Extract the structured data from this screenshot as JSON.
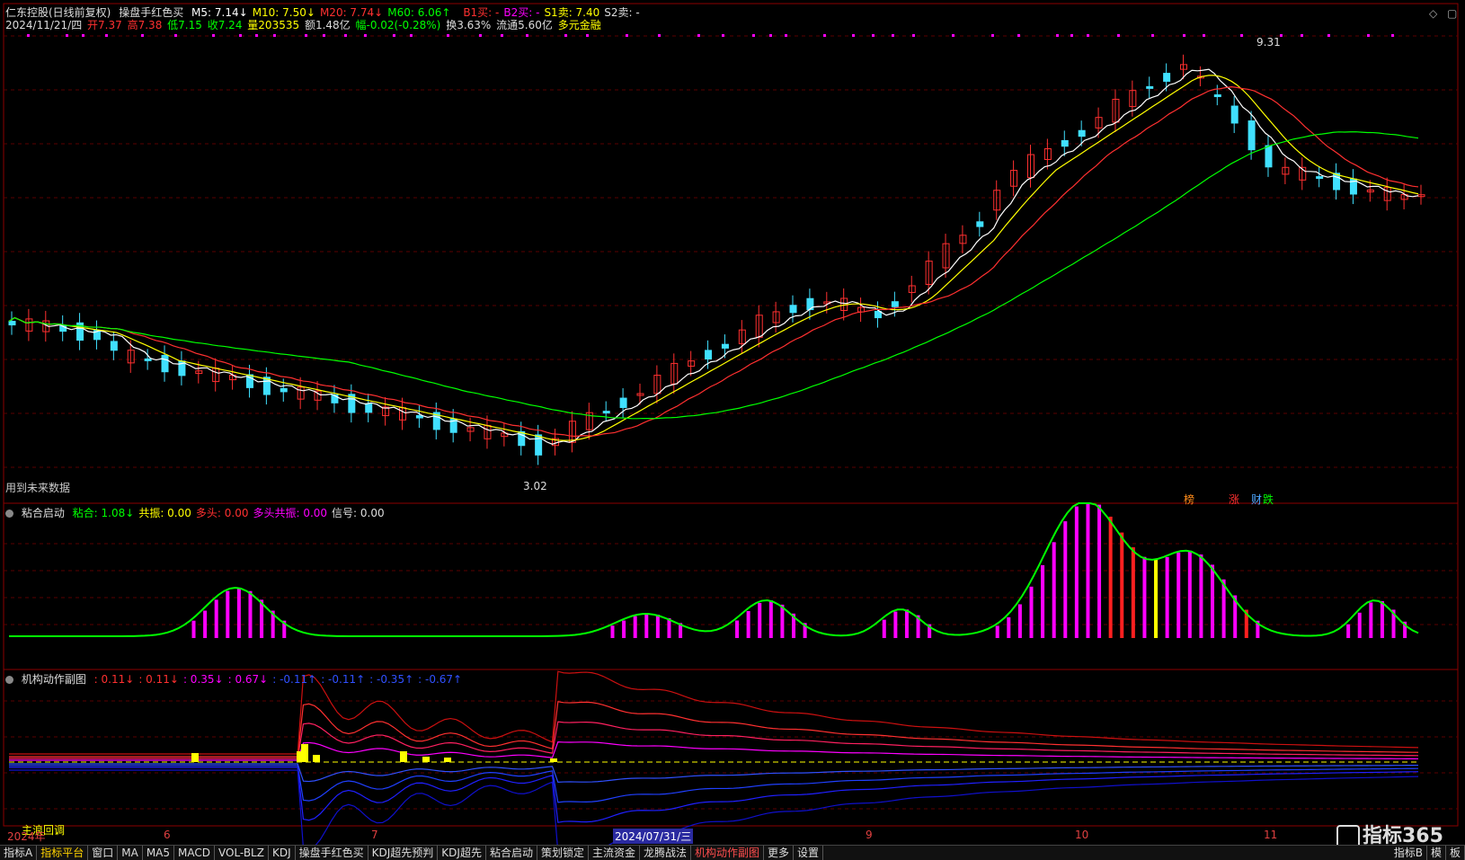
{
  "main": {
    "stock_name": "仁东控股(日线前复权)",
    "indicator_name": "操盘手红色买",
    "ma": [
      {
        "label": "M5: 7.14",
        "arrow": "↓",
        "color": "#ffffff"
      },
      {
        "label": "M10: 7.50",
        "arrow": "↓",
        "color": "#ffff00"
      },
      {
        "label": "M20: 7.74",
        "arrow": "↓",
        "color": "#ff3030"
      },
      {
        "label": "M60: 6.06",
        "arrow": "↑",
        "color": "#00ff00"
      }
    ],
    "signals": [
      {
        "label": "B1买: -",
        "color": "#ff3030"
      },
      {
        "label": "B2买: -",
        "color": "#ff00ff"
      },
      {
        "label": "S1卖: 7.40",
        "color": "#ffff00"
      },
      {
        "label": "S2卖: -",
        "color": "#dddddd"
      }
    ],
    "quote": {
      "date": "2024/11/21/四",
      "open": "开7.37",
      "high": "高7.38",
      "low": "低7.15",
      "close": "收7.24",
      "volume": "量203535",
      "amount": "额1.48亿",
      "change": "幅-0.02(-0.28%)",
      "turnover": "换3.63%",
      "float": "流通5.60亿",
      "tag": "多元金融"
    },
    "high_label": "9.31",
    "low_label": "3.02",
    "future_note": "用到未来数据",
    "badges": [
      "榜",
      "涨",
      "财",
      "跌"
    ]
  },
  "ind1": {
    "name": "粘合启动",
    "values": [
      {
        "label": "粘合: 1.08",
        "arrow": "↓",
        "color": "#00ff00"
      },
      {
        "label": "共振: 0.00",
        "arrow": "",
        "color": "#ffff00"
      },
      {
        "label": "多头: 0.00",
        "arrow": "",
        "color": "#ff3030"
      },
      {
        "label": "多头共振: 0.00",
        "arrow": "",
        "color": "#ff00ff"
      },
      {
        "label": "信号: 0.00",
        "arrow": "",
        "color": "#dddddd"
      }
    ]
  },
  "ind2": {
    "name": "机构动作副图",
    "values": [
      {
        "label": ": 0.11",
        "arrow": "↓",
        "color": "#ff3030"
      },
      {
        "label": ": 0.11",
        "arrow": "↓",
        "color": "#ff3030"
      },
      {
        "label": ": 0.35",
        "arrow": "↓",
        "color": "#ff00ff"
      },
      {
        "label": ": 0.67",
        "arrow": "↓",
        "color": "#ff00ff"
      },
      {
        "label": ": -0.11",
        "arrow": "↑",
        "color": "#3050ff"
      },
      {
        "label": ": -0.11",
        "arrow": "↑",
        "color": "#3050ff"
      },
      {
        "label": ": -0.35",
        "arrow": "↑",
        "color": "#3050ff"
      },
      {
        "label": ": -0.67",
        "arrow": "↑",
        "color": "#3050ff"
      }
    ],
    "note": "主浪回调"
  },
  "xaxis": {
    "labels": [
      "2024年",
      "6",
      "7",
      "2024/07/31/三",
      "9",
      "10",
      "11"
    ]
  },
  "tabs": [
    "指标A",
    "指标平台",
    "窗口",
    "MA",
    "MA5",
    "MACD",
    "VOL-BLZ",
    "KDJ",
    "操盘手红色买",
    "KDJ超先预判",
    "KDJ超先",
    "粘合启动",
    "策划锁定",
    "主流资金",
    "龙腾战法",
    "机构动作副图",
    "更多",
    "设置"
  ],
  "right_tabs": [
    "指标B",
    "模",
    "板"
  ],
  "watermark": "指标365"
}
